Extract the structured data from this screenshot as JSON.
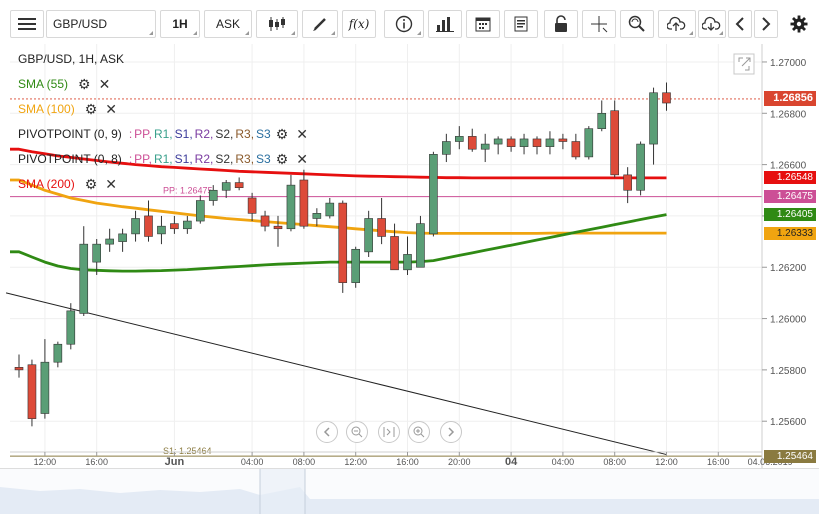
{
  "toolbar": {
    "symbol": "GBP/USD",
    "timeframe": "1H",
    "price_side": "ASK",
    "fx_label": "f(x)",
    "icons": [
      "menu-icon",
      "candles-icon",
      "draw-icon",
      "indicator-icon",
      "info-icon",
      "bars-icon",
      "calendar-icon",
      "report-icon",
      "lock-icon",
      "crosshair-icon",
      "zoom-icon",
      "upload-icon",
      "download-icon",
      "chevron-left-icon",
      "chevron-right-icon",
      "gear-icon"
    ]
  },
  "chart_header": "GBP/USD, 1H, ASK",
  "legend": {
    "sma55": "SMA (55)",
    "sma100": "SMA (100)",
    "pivot9": "PIVOTPOINT (0, 9)",
    "pivot8": "PIVOTPOINT (0, 8)",
    "sma200": "SMA (200)",
    "pivot_params_sep": ":",
    "pivot_params": [
      "PP,",
      "R1,",
      "S1,",
      "R2,",
      "S2,",
      "R3,",
      "S3"
    ],
    "gear_glyph": "⚙",
    "close_glyph": "✕"
  },
  "colors": {
    "bull": "#5a9e76",
    "bear": "#dd4b39",
    "sma55": "#2f8a14",
    "sma100": "#f0a410",
    "sma200": "#e60f0f",
    "pivot": "#cc4f96",
    "s1": "#8a7a40",
    "last": "#d9452f",
    "pp_param": "#cc4f96",
    "r1_param": "#3aa08c",
    "s1_param": "#3b3b9a",
    "r2_param": "#7a3aa0",
    "s2_param": "#333333",
    "r3_param": "#8a5a2b",
    "s3_param": "#2a6fa0"
  },
  "chart_data": {
    "type": "candlestick",
    "symbol": "GBP/USD",
    "timeframe": "1H",
    "ylim": [
      1.2548,
      1.2707
    ],
    "y_ticks": [
      1.256,
      1.258,
      1.26,
      1.262,
      1.264,
      1.266,
      1.268,
      1.27
    ],
    "y_tick_labels": [
      "1.25600",
      "1.25800",
      "1.26000",
      "1.26200",
      "1.26400",
      "1.26600",
      "1.26800",
      "1.27000"
    ],
    "x_ticks": [
      {
        "slot": 2,
        "label": "12:00"
      },
      {
        "slot": 6,
        "label": "16:00"
      },
      {
        "slot": 12,
        "label": "Jun"
      },
      {
        "slot": 18,
        "label": "04:00"
      },
      {
        "slot": 22,
        "label": "08:00"
      },
      {
        "slot": 26,
        "label": "12:00"
      },
      {
        "slot": 30,
        "label": "16:00"
      },
      {
        "slot": 34,
        "label": "20:00"
      },
      {
        "slot": 38,
        "label": "04"
      },
      {
        "slot": 42,
        "label": "04:00"
      },
      {
        "slot": 46,
        "label": "08:00"
      },
      {
        "slot": 50,
        "label": "12:00"
      },
      {
        "slot": 54,
        "label": "16:00"
      },
      {
        "slot": 58,
        "label": "04.06.2019"
      }
    ],
    "candles": [
      {
        "o": 1.2581,
        "h": 1.2586,
        "l": 1.2577,
        "c": 1.258
      },
      {
        "o": 1.2582,
        "h": 1.2584,
        "l": 1.2558,
        "c": 1.2561
      },
      {
        "o": 1.2563,
        "h": 1.2592,
        "l": 1.2561,
        "c": 1.2583
      },
      {
        "o": 1.2583,
        "h": 1.2591,
        "l": 1.2581,
        "c": 1.259
      },
      {
        "o": 1.259,
        "h": 1.2606,
        "l": 1.2588,
        "c": 1.2603
      },
      {
        "o": 1.2602,
        "h": 1.2636,
        "l": 1.2601,
        "c": 1.2629
      },
      {
        "o": 1.2622,
        "h": 1.2631,
        "l": 1.2617,
        "c": 1.2629
      },
      {
        "o": 1.2629,
        "h": 1.2635,
        "l": 1.2626,
        "c": 1.2631
      },
      {
        "o": 1.263,
        "h": 1.2635,
        "l": 1.2626,
        "c": 1.2633
      },
      {
        "o": 1.2633,
        "h": 1.2642,
        "l": 1.263,
        "c": 1.2639
      },
      {
        "o": 1.264,
        "h": 1.2646,
        "l": 1.263,
        "c": 1.2632
      },
      {
        "o": 1.2633,
        "h": 1.264,
        "l": 1.2629,
        "c": 1.2636
      },
      {
        "o": 1.2637,
        "h": 1.264,
        "l": 1.2633,
        "c": 1.2635
      },
      {
        "o": 1.2635,
        "h": 1.264,
        "l": 1.2633,
        "c": 1.2638
      },
      {
        "o": 1.2638,
        "h": 1.2648,
        "l": 1.2637,
        "c": 1.2646
      },
      {
        "o": 1.2646,
        "h": 1.2652,
        "l": 1.2644,
        "c": 1.265
      },
      {
        "o": 1.265,
        "h": 1.2654,
        "l": 1.2647,
        "c": 1.2653
      },
      {
        "o": 1.2653,
        "h": 1.2655,
        "l": 1.265,
        "c": 1.2651
      },
      {
        "o": 1.2647,
        "h": 1.2649,
        "l": 1.2638,
        "c": 1.2641
      },
      {
        "o": 1.264,
        "h": 1.2642,
        "l": 1.2634,
        "c": 1.2636
      },
      {
        "o": 1.2636,
        "h": 1.264,
        "l": 1.2628,
        "c": 1.2635
      },
      {
        "o": 1.2635,
        "h": 1.2656,
        "l": 1.2634,
        "c": 1.2652
      },
      {
        "o": 1.2654,
        "h": 1.2658,
        "l": 1.2635,
        "c": 1.2636
      },
      {
        "o": 1.2639,
        "h": 1.2643,
        "l": 1.2636,
        "c": 1.2641
      },
      {
        "o": 1.264,
        "h": 1.2647,
        "l": 1.2639,
        "c": 1.2645
      },
      {
        "o": 1.2645,
        "h": 1.2646,
        "l": 1.261,
        "c": 1.2614
      },
      {
        "o": 1.2614,
        "h": 1.2628,
        "l": 1.2612,
        "c": 1.2627
      },
      {
        "o": 1.2626,
        "h": 1.2642,
        "l": 1.2624,
        "c": 1.2639
      },
      {
        "o": 1.2639,
        "h": 1.2647,
        "l": 1.2629,
        "c": 1.2632
      },
      {
        "o": 1.2632,
        "h": 1.2637,
        "l": 1.2619,
        "c": 1.2619
      },
      {
        "o": 1.2619,
        "h": 1.2632,
        "l": 1.2617,
        "c": 1.2625
      },
      {
        "o": 1.262,
        "h": 1.264,
        "l": 1.262,
        "c": 1.2637
      },
      {
        "o": 1.2633,
        "h": 1.2665,
        "l": 1.2632,
        "c": 1.2664
      },
      {
        "o": 1.2664,
        "h": 1.2672,
        "l": 1.2661,
        "c": 1.2669
      },
      {
        "o": 1.2669,
        "h": 1.2675,
        "l": 1.2666,
        "c": 1.2671
      },
      {
        "o": 1.2671,
        "h": 1.2674,
        "l": 1.2665,
        "c": 1.2666
      },
      {
        "o": 1.2666,
        "h": 1.2672,
        "l": 1.2661,
        "c": 1.2668
      },
      {
        "o": 1.2668,
        "h": 1.2671,
        "l": 1.2664,
        "c": 1.267
      },
      {
        "o": 1.267,
        "h": 1.2671,
        "l": 1.2665,
        "c": 1.2667
      },
      {
        "o": 1.2667,
        "h": 1.2672,
        "l": 1.2664,
        "c": 1.267
      },
      {
        "o": 1.267,
        "h": 1.2671,
        "l": 1.2664,
        "c": 1.2667
      },
      {
        "o": 1.2667,
        "h": 1.2673,
        "l": 1.2664,
        "c": 1.267
      },
      {
        "o": 1.267,
        "h": 1.2672,
        "l": 1.2666,
        "c": 1.2669
      },
      {
        "o": 1.2669,
        "h": 1.2672,
        "l": 1.2662,
        "c": 1.2663
      },
      {
        "o": 1.2663,
        "h": 1.2675,
        "l": 1.2662,
        "c": 1.2674
      },
      {
        "o": 1.2674,
        "h": 1.2685,
        "l": 1.2673,
        "c": 1.268
      },
      {
        "o": 1.2681,
        "h": 1.2685,
        "l": 1.2655,
        "c": 1.2656
      },
      {
        "o": 1.2656,
        "h": 1.2659,
        "l": 1.2645,
        "c": 1.265
      },
      {
        "o": 1.265,
        "h": 1.2669,
        "l": 1.2648,
        "c": 1.2668
      },
      {
        "o": 1.2668,
        "h": 1.269,
        "l": 1.266,
        "c": 1.2688
      },
      {
        "o": 1.2688,
        "h": 1.2692,
        "l": 1.2681,
        "c": 1.2684
      }
    ],
    "sma200": [
      1.2666,
      1.2665,
      1.26642,
      1.26634,
      1.26628,
      1.26622,
      1.26616,
      1.2661,
      1.26605,
      1.266,
      1.26596,
      1.26592,
      1.26589,
      1.26586,
      1.26583,
      1.2658,
      1.26577,
      1.26574,
      1.26572,
      1.2657,
      1.26568,
      1.26566,
      1.26564,
      1.26562,
      1.2656,
      1.26558,
      1.26556,
      1.26555,
      1.26554,
      1.26553,
      1.26552,
      1.26551,
      1.2655,
      1.26549,
      1.26549,
      1.26548,
      1.26548,
      1.26548,
      1.26548,
      1.26548,
      1.26548,
      1.26548,
      1.26548,
      1.26548,
      1.26548,
      1.26548,
      1.26548,
      1.26548,
      1.26548,
      1.26548,
      1.26548
    ],
    "sma100": [
      1.2654,
      1.2652,
      1.265,
      1.26485,
      1.2647,
      1.2646,
      1.2645,
      1.26443,
      1.26436,
      1.2643,
      1.26424,
      1.26418,
      1.26412,
      1.26406,
      1.264,
      1.26395,
      1.2639,
      1.26386,
      1.26382,
      1.26378,
      1.26374,
      1.2637,
      1.26366,
      1.26362,
      1.26358,
      1.26354,
      1.2635,
      1.26346,
      1.26342,
      1.26338,
      1.26335,
      1.26333,
      1.26332,
      1.26332,
      1.26332,
      1.26332,
      1.26332,
      1.26332,
      1.26332,
      1.26332,
      1.26332,
      1.26333,
      1.26333,
      1.26333,
      1.26333,
      1.26333,
      1.26333,
      1.26333,
      1.26333,
      1.26333,
      1.26333
    ],
    "sma55": [
      1.2626,
      1.2624,
      1.2622,
      1.26205,
      1.26195,
      1.2619,
      1.26188,
      1.26186,
      1.26185,
      1.26185,
      1.26186,
      1.26187,
      1.26189,
      1.26191,
      1.26194,
      1.26197,
      1.262,
      1.26203,
      1.26206,
      1.26209,
      1.26212,
      1.26214,
      1.26216,
      1.26218,
      1.2622,
      1.2622,
      1.2622,
      1.2622,
      1.2622,
      1.2622,
      1.2622,
      1.26222,
      1.26226,
      1.26236,
      1.26246,
      1.26256,
      1.26266,
      1.26276,
      1.26286,
      1.26296,
      1.26306,
      1.26316,
      1.26326,
      1.26336,
      1.26346,
      1.26356,
      1.26366,
      1.26376,
      1.26386,
      1.26396,
      1.26405
    ],
    "trendline": [
      {
        "slot": -1,
        "price": 1.261
      },
      {
        "slot": 50,
        "price": 1.2547
      }
    ],
    "pivot_pp": 1.26475,
    "pivot_pp_label": "PP: 1.26475",
    "s1": 1.25464,
    "s1_label": "S1: 1.25464",
    "last_price": 1.26856,
    "last_price_label": "1.26856",
    "price_tags": [
      {
        "key": "last",
        "label": "1.26856",
        "price": 1.26856
      },
      {
        "key": "sma200",
        "label": "1.26548",
        "price": 1.26548
      },
      {
        "key": "pivot",
        "label": "1.26475",
        "price": 1.26475
      },
      {
        "key": "sma55",
        "label": "1.26405",
        "price": 1.26405
      },
      {
        "key": "sma100",
        "label": "1.26333",
        "price": 1.26333
      },
      {
        "key": "s1",
        "label": "1.25464",
        "price": 1.25464
      }
    ]
  }
}
